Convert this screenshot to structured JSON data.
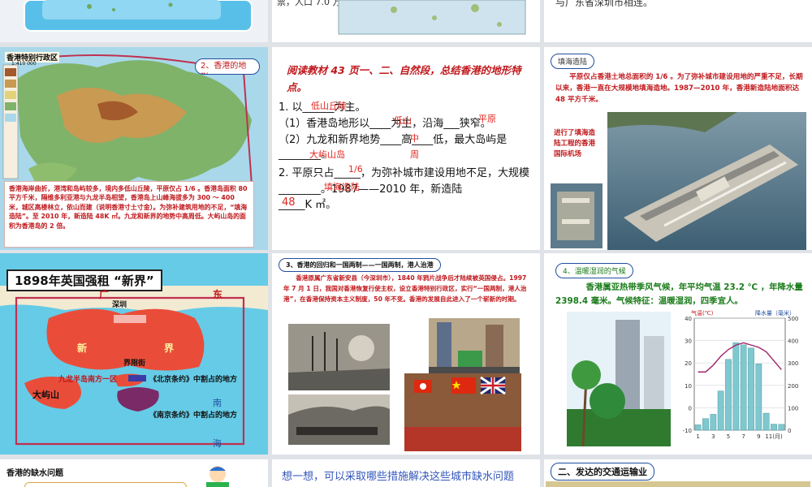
{
  "top_row": {
    "left_partial": "",
    "middle_partial": "票，人口 7.0 万。",
    "right_partial": "与广东省深圳市相连。"
  },
  "slide_map": {
    "map_title": "香港特别行政区",
    "map_scale": "1:410 000",
    "badge": "2、香港的地形",
    "caption": "香港海岸曲折，港湾和岛屿较多，境内多低山丘陵，平原仅占 1/6 。香港岛面积 80 平方千米，隔维多利亚港与九龙半岛相望，香港岛上山峰海拔多为 300 ～ 400 米，城区高楼林立，依山而建（说明香港寸土寸金）。为弥补建筑用地的不足，“填海造陆”。至 2010 年，新造陆 48K ㎡。九龙和新界的地势中高周低。大屿山岛的面积为香港岛的 2 倍。"
  },
  "slide_terrain": {
    "heading": "阅读教材 43 页一、二、自然段，总结香港的地形特点。",
    "line1": "1. 以______为主。",
    "line2": "（1）香港岛地形以____为主，沿海___狭窄。",
    "line3": "（2）九龙和新界地势____高____低，最大岛屿是________。",
    "line4": "2. 平原只占_____，为弥补城市建设用地不足，大规模________。1987——2010 年，新造陆",
    "line5": "_____K ㎡。",
    "answers": {
      "low_hills": "低山丘陵",
      "low_mountain": "低山",
      "plain": "平原",
      "center": "中",
      "periphery": "周",
      "island": "大屿山岛",
      "fraction": "1/6",
      "reclaim": "填海造陆",
      "area": "48"
    }
  },
  "slide_reclaim": {
    "badge": "填海造陆",
    "text": "平原仅占香港土地总面积的 1/6 。为了弥补城市建设用地的严重不足，长期以来，香港一直在大规模地填海造地。1987—2010 年，香港新造陆地面积达 48 平方千米。",
    "side_text": "进行了填海造陆工程的香港国际机场"
  },
  "slide_1898": {
    "title": "1898年英国强租 “新界”",
    "labels": {
      "guang": "广",
      "dong": "东",
      "shenzhen": "深圳",
      "xinjie": "新",
      "jie": "界",
      "boundary_river": "界限街",
      "kowloon": "九龙半岛南方一区",
      "lantau": "大屿山",
      "nan": "南",
      "hai": "海",
      "beijing_treaty": "《北京条约》中割占的地方",
      "nanjing_treaty": "《南京条约》中割占的地方"
    }
  },
  "slide_history": {
    "badge": "3、香港的回归和一国两制——一国两制，港人治港",
    "text": "香港原属广东省新安县（今深圳市），1840 年鸦片战争后才陆续被英国侵占。1997 年 7 月 1 日，我国对香港恢复行使主权，设立香港特别行政区，实行“一国两制，港人治港”，在香港保持资本主义制度，50 年不变。香港的发展自此进入了一个崭新的时期。"
  },
  "slide_climate": {
    "badge": "4、温暖湿润的气候",
    "text": "香港属亚热带季风气候，年平均气温 23.2 ℃ ，年降水量 2398.4 毫米。气候特征：温暖湿润，四季宜人。",
    "temp_axis": "气温(℃)",
    "precip_axis": "降水量（毫米）",
    "month_label": "(月)",
    "y_left_ticks": [
      "40",
      "30",
      "20",
      "10",
      "0",
      "-10"
    ],
    "y_right_ticks": [
      "500",
      "400",
      "300",
      "200",
      "100",
      "0"
    ],
    "x_ticks": [
      "1",
      "3",
      "5",
      "7",
      "9",
      "11(月)"
    ]
  },
  "chart_data": {
    "type": "bar",
    "categories": [
      "1",
      "2",
      "3",
      "4",
      "5",
      "6",
      "7",
      "8",
      "9",
      "10",
      "11",
      "12"
    ],
    "series": [
      {
        "values": [
          24,
          52,
          71,
          175,
          316,
          391,
          381,
          367,
          296,
          76,
          27,
          26
        ]
      },
      {
        "values": [
          16,
          16,
          19,
          23,
          26,
          28,
          29,
          28,
          27,
          25,
          21,
          17
        ]
      }
    ],
    "ylabel": "气温(℃)",
    "y2label": "降水量（毫米）",
    "ylim": [
      -10,
      40
    ],
    "y2lim": [
      0,
      500
    ]
  },
  "bottom_row": {
    "water_title": "香港的缺水问题",
    "think_title": "想一想，可以采取哪些措施解决这些城市缺水问题",
    "transport_title": "二、发达的交通运输业"
  },
  "colors": {
    "bg": "#dfe3e8",
    "heading_red": "#c0181c",
    "answer_red": "#e0251f",
    "badge_border": "#1f4e9e",
    "green_text": "#1b7c1b",
    "chart_bar": "#7fc8cf",
    "chart_line": "#a0236a",
    "think_blue": "#3355bb"
  }
}
